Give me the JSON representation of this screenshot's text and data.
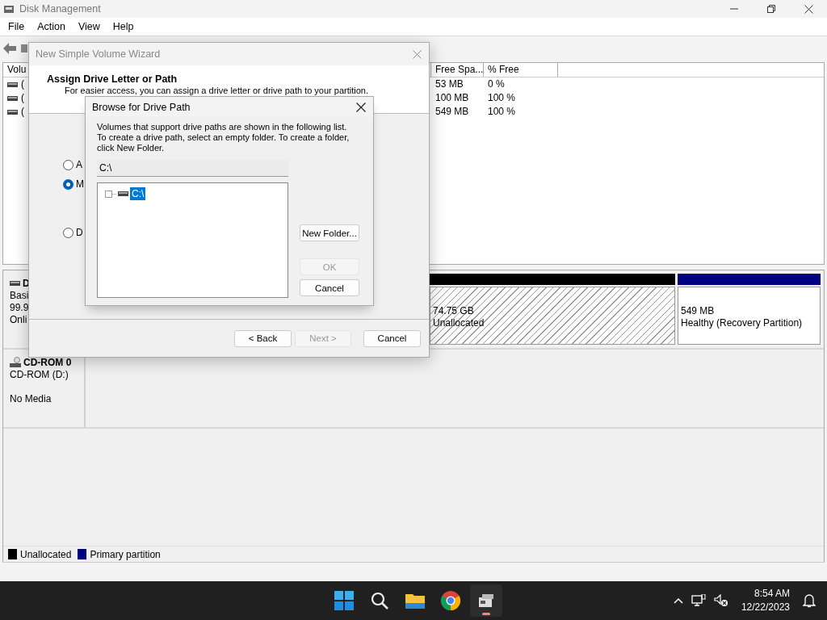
{
  "window": {
    "title": "Disk Management"
  },
  "menu": [
    "File",
    "Action",
    "View",
    "Help"
  ],
  "volume_table": {
    "columns": [
      "Volu",
      "Free Spa...",
      "% Free"
    ],
    "rows": [
      [
        "(",
        "53 MB",
        "0 %"
      ],
      [
        "(",
        "100 MB",
        "100 %"
      ],
      [
        "(",
        "549 MB",
        "100 %"
      ]
    ]
  },
  "disks": [
    {
      "kind": "disk",
      "name": "D",
      "type": "Basi",
      "size": "99.9",
      "status": "Onli",
      "partitions": [
        {
          "kind": "unallocated",
          "size": "74.75 GB",
          "status": "Unallocated",
          "color": "#000000"
        },
        {
          "kind": "primary",
          "size": "549 MB",
          "status": "Healthy (Recovery Partition)",
          "color": "#000080"
        }
      ]
    },
    {
      "kind": "cdrom",
      "name": "CD-ROM 0",
      "type": "CD-ROM (D:)",
      "status": "No Media"
    }
  ],
  "legend": [
    {
      "label": "Unallocated",
      "color": "#000000"
    },
    {
      "label": "Primary partition",
      "color": "#000080"
    }
  ],
  "wizard": {
    "title": "New Simple Volume Wizard",
    "heading": "Assign Drive Letter or Path",
    "subtitle": "For easier access, you can assign a drive letter or drive path to your partition.",
    "options": [
      {
        "label": "A",
        "selected": false
      },
      {
        "label": "M",
        "selected": true
      },
      {
        "label": "D",
        "selected": false
      }
    ],
    "buttons": [
      {
        "label": "< Back",
        "disabled": false
      },
      {
        "label": "Next >",
        "disabled": true
      },
      {
        "label": "Cancel",
        "disabled": false
      }
    ]
  },
  "browse_dialog": {
    "title": "Browse for Drive Path",
    "instructions": "Volumes that support drive paths are shown in the following list.\nTo create a drive path, select an empty folder. To create a folder,\nclick New Folder.",
    "path_field": {
      "value": "C:\\"
    },
    "tree": [
      {
        "label": "C:\\",
        "selected": true
      }
    ],
    "buttons": [
      {
        "label": "New Folder...",
        "disabled": false
      },
      {
        "label": "OK",
        "disabled": true
      },
      {
        "label": "Cancel",
        "disabled": false
      }
    ]
  },
  "taskbar": {
    "time": "8:54 AM",
    "date": "12/22/2023"
  }
}
